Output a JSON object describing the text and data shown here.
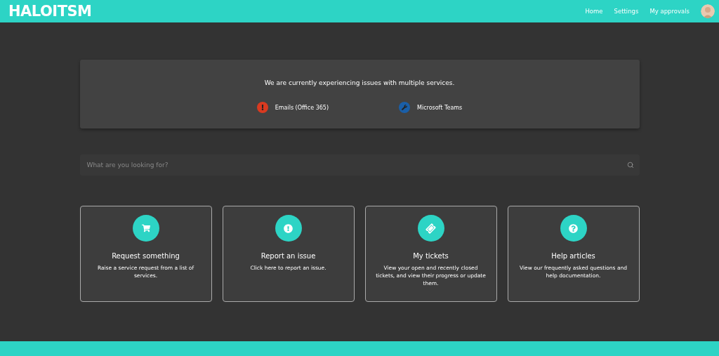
{
  "header": {
    "logo": "HALOITSM",
    "nav": [
      {
        "label": "Home"
      },
      {
        "label": "Settings"
      },
      {
        "label": "My approvals"
      }
    ]
  },
  "banner": {
    "message": "We are currently experiencing issues with multiple services.",
    "services": [
      {
        "name": "Emails (Office 365)",
        "kind": "alert",
        "color": "#d93a20"
      },
      {
        "name": "Microsoft Teams",
        "kind": "wrench",
        "color": "#1a5fa8"
      }
    ]
  },
  "search": {
    "placeholder": "What are you looking for?"
  },
  "cards": [
    {
      "kind": "cart",
      "title": "Request something",
      "description": "Raise a service request from a list of services."
    },
    {
      "kind": "alert",
      "title": "Report an issue",
      "description": "Click here to report an issue."
    },
    {
      "kind": "ticket",
      "title": "My tickets",
      "description": "View your open and recently closed tickets, and view their progress or update them."
    },
    {
      "kind": "help",
      "title": "Help articles",
      "description": "View our frequently asked questions and help documentation."
    }
  ]
}
